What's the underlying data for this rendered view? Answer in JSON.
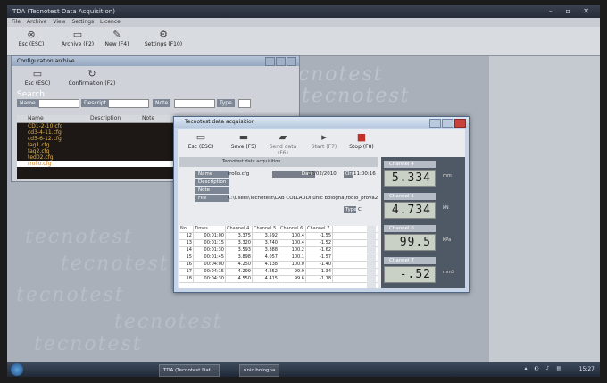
{
  "app": {
    "title": "TDA (Tecnotest Data Acquisition)",
    "menu": [
      "File",
      "Archive",
      "View",
      "Settings",
      "Licence"
    ],
    "toolbar": [
      {
        "label": "Esc (ESC)",
        "icon": "close-circle-icon"
      },
      {
        "label": "Archive (F2)",
        "icon": "archive-icon"
      },
      {
        "label": "New (F4)",
        "icon": "new-icon"
      },
      {
        "label": "Settings (F10)",
        "icon": "settings-icon"
      }
    ]
  },
  "watermark": "tecnotest",
  "config_archive": {
    "title": "Configuration archive",
    "toolbar": [
      {
        "label": "Esc (ESC)"
      },
      {
        "label": "Confirmation (F2)"
      }
    ],
    "search": {
      "label": "Search",
      "fields": [
        "Name",
        "Descript",
        "Note",
        "Type"
      ]
    },
    "columns": [
      "Name",
      "Description",
      "Note"
    ],
    "files": [
      "CD1-2-10.cfg",
      "cd3-4-11.cfg",
      "cd5-6-12.cfg",
      "fag1.cfg",
      "fag2.cfg",
      "ted02.cfg",
      "rrollo.cfg"
    ],
    "selected_file": "rrollo.cfg"
  },
  "dialog": {
    "title": "Tecnotest data acquisition",
    "toolbar": [
      {
        "label": "Esc (ESC)"
      },
      {
        "label": "Save (F5)"
      },
      {
        "label": "Send data (F6)"
      },
      {
        "label": "Start (F7)"
      },
      {
        "label": "Stop (F8)"
      }
    ],
    "config_title": "Tecnotest data acquisition",
    "form": {
      "name_label": "Name",
      "name_value": "rrollo.cfg",
      "date_label": "Data",
      "date_value": "12/02/2010",
      "time_label": "Ora",
      "time_value": "11:00:16",
      "description_label": "Description",
      "note_label": "Note",
      "file_label": "File",
      "file_value": "C:\\Users\\Tecnotest\\LAB COLLAUDI\\unic bologna\\rodio_prova2",
      "type_label": "Type",
      "type_value": "C"
    },
    "table": {
      "columns": [
        "No.",
        "Times",
        "Channel 4",
        "Channel 5",
        "Channel 6",
        "Channel 7"
      ],
      "rows": [
        [
          "12",
          "00:01:00",
          "3.375",
          "3.592",
          "100.4",
          "-1.55"
        ],
        [
          "13",
          "00:01:15",
          "3.320",
          "3.740",
          "100.4",
          "-1.52"
        ],
        [
          "14",
          "00:01:30",
          "3.593",
          "3.888",
          "100.2",
          "-1.62"
        ],
        [
          "15",
          "00:01:45",
          "3.898",
          "4.057",
          "100.1",
          "-1.57"
        ],
        [
          "16",
          "00:04:00",
          "4.250",
          "4.138",
          "100.0",
          "-1.40"
        ],
        [
          "17",
          "00:04:15",
          "4.299",
          "4.252",
          "99.9",
          "-1.34"
        ],
        [
          "18",
          "00:04:30",
          "4.550",
          "4.415",
          "99.6",
          "-1.18"
        ]
      ]
    },
    "channels": [
      {
        "name": "Channel 4",
        "value": "5.334",
        "unit": "mm"
      },
      {
        "name": "Channel 5",
        "value": "4.734",
        "unit": "kN"
      },
      {
        "name": "Channel 6",
        "value": "99.5",
        "unit": "KPa"
      },
      {
        "name": "Channel 7",
        "value": "-.52",
        "unit": "mm3"
      }
    ]
  },
  "taskbar": {
    "items": [
      "TDA (Tecnotest Dat...",
      "unic bologna"
    ],
    "clock": "15:27"
  }
}
